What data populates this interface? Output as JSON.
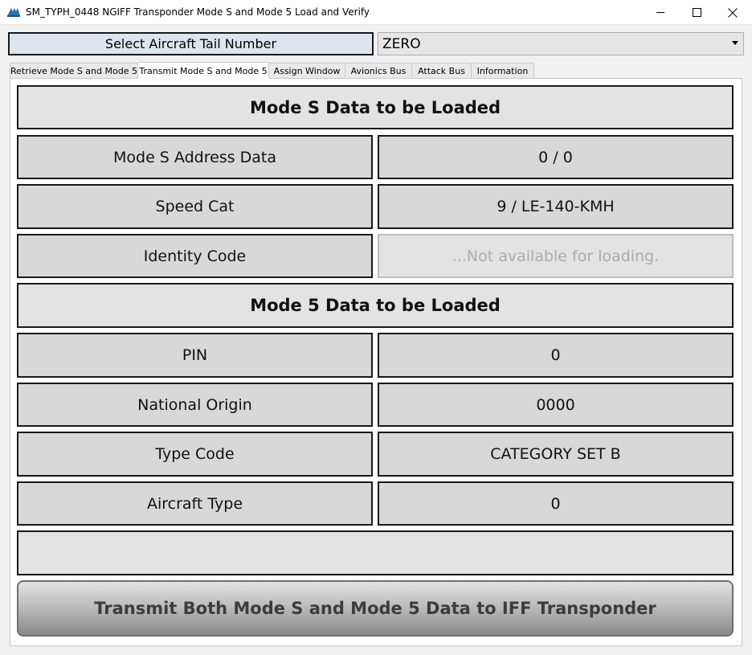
{
  "window": {
    "title": "SM_TYPH_0448 NGIFF Transponder Mode S and Mode 5 Load and Verify",
    "app_icon": "aircraft-logo-icon",
    "controls": [
      "minimize-icon",
      "maximize-icon",
      "close-icon"
    ]
  },
  "tail": {
    "button_label": "Select Aircraft Tail Number",
    "selected_value": "ZERO"
  },
  "tabs": [
    {
      "label": "Retrieve Mode S and Mode 5",
      "active": false
    },
    {
      "label": "Transmit Mode S and Mode 5",
      "active": true
    },
    {
      "label": "Assign Window",
      "active": false
    },
    {
      "label": "Avionics Bus",
      "active": false
    },
    {
      "label": "Attack Bus",
      "active": false
    },
    {
      "label": "Information",
      "active": false
    }
  ],
  "mode_s": {
    "header": "Mode S Data to be Loaded",
    "rows": [
      {
        "label": "Mode S Address Data",
        "value": "0 / 0"
      },
      {
        "label": "Speed Cat",
        "value": "9 / LE-140-KMH"
      },
      {
        "label": "Identity Code",
        "value": "...Not available for loading."
      }
    ]
  },
  "mode_5": {
    "header": "Mode 5 Data to be Loaded",
    "rows": [
      {
        "label": "PIN",
        "value": "0"
      },
      {
        "label": "National Origin",
        "value": "0000"
      },
      {
        "label": "Type Code",
        "value": "CATEGORY SET B"
      },
      {
        "label": "Aircraft Type",
        "value": "0"
      }
    ]
  },
  "status_text": "",
  "transmit_label": "Transmit Both Mode S and Mode 5 Data to IFF Transponder",
  "colors": {
    "cell_fill": "#d8d8d8",
    "header_fill": "#e3e3e3",
    "tail_button_fill": "#dde5ee",
    "disabled_text": "#ababab"
  }
}
